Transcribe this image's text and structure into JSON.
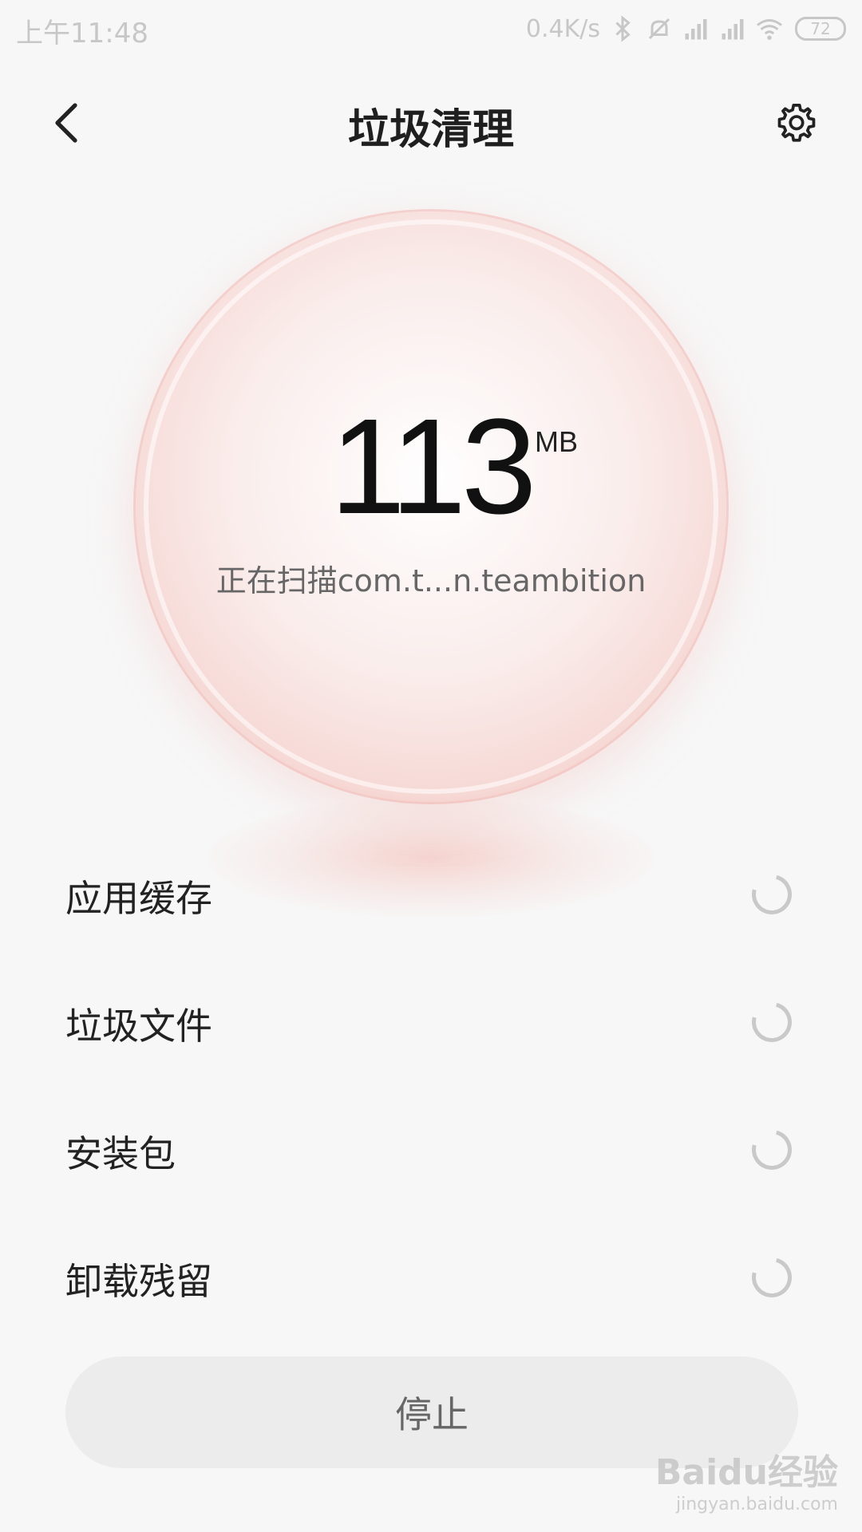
{
  "status_bar": {
    "time": "上午11:48",
    "net_speed": "0.4K/s",
    "battery": "72",
    "icons": [
      "bluetooth-icon",
      "mute-icon",
      "signal-icon",
      "signal-icon",
      "wifi-icon",
      "battery-icon"
    ]
  },
  "header": {
    "title": "垃圾清理",
    "back_icon": "chevron-left-icon",
    "settings_icon": "gear-icon"
  },
  "scan": {
    "size_value": "113",
    "size_unit": "MB",
    "status_text": "正在扫描com.t...n.teambition",
    "accent_color": "#f08c80"
  },
  "categories": [
    {
      "label": "应用缓存",
      "state": "loading"
    },
    {
      "label": "垃圾文件",
      "state": "loading"
    },
    {
      "label": "安装包",
      "state": "loading"
    },
    {
      "label": "卸载残留",
      "state": "loading"
    }
  ],
  "actions": {
    "stop_label": "停止"
  },
  "watermark": {
    "logo": "Baidu经验",
    "url": "jingyan.baidu.com"
  }
}
